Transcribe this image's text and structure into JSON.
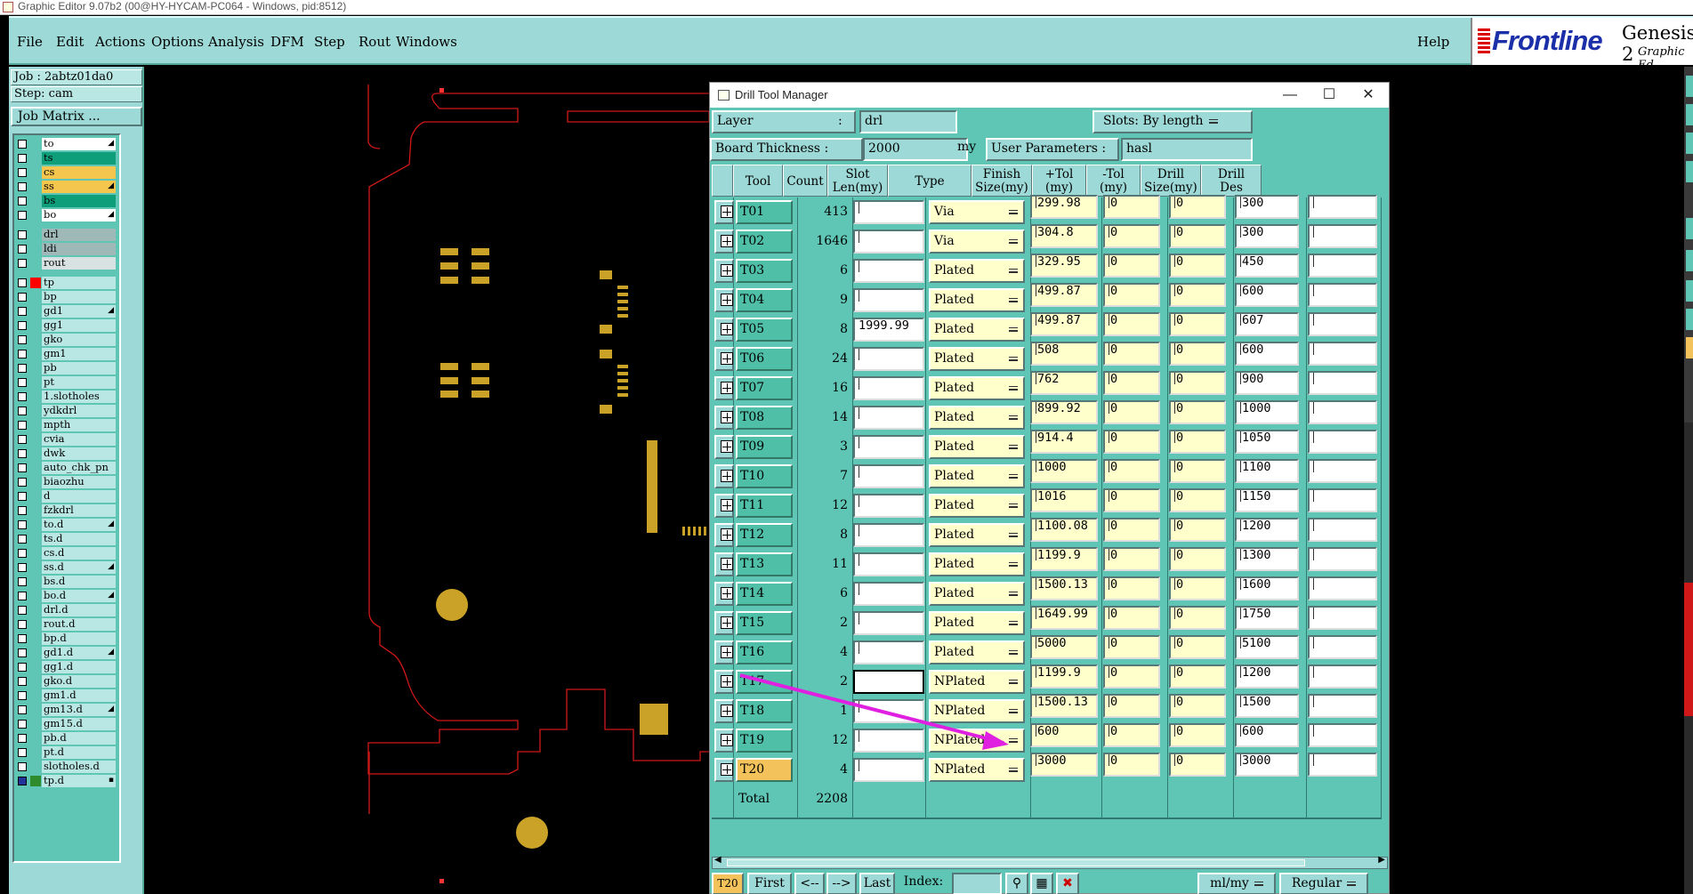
{
  "window": {
    "title": "Graphic Editor 9.07b2 (00@HY-HYCAM-PC064 - Windows, pid:8512)"
  },
  "menu": {
    "items": [
      "File",
      "Edit",
      "Actions",
      "Options",
      "Analysis",
      "DFM",
      "Step",
      "Rout",
      "Windows"
    ],
    "help": "Help"
  },
  "logo": {
    "brand": "Frontline",
    "product": "Genesis 2",
    "subtitle": "Graphic Ed"
  },
  "left_panel": {
    "job": "Job : 2abtz01da0",
    "step": "Step: cam",
    "job_matrix": "Job Matrix ...",
    "layers": [
      {
        "name": "to",
        "color": "#ffffff",
        "mark": "◢"
      },
      {
        "name": "ts",
        "color": "#0f9e7a",
        "mark": ""
      },
      {
        "name": "cs",
        "color": "#f5c64e",
        "mark": ""
      },
      {
        "name": "ss",
        "color": "#f5c64e",
        "mark": "◢"
      },
      {
        "name": "bs",
        "color": "#0f9e7a",
        "mark": ""
      },
      {
        "name": "bo",
        "color": "#ffffff",
        "mark": "◢"
      },
      {
        "name": "drl",
        "color": "#9fb8b8",
        "mark": ""
      },
      {
        "name": "ldi",
        "color": "#9fb8b8",
        "mark": ""
      },
      {
        "name": "rout",
        "color": "#d8e2e2",
        "mark": ""
      },
      {
        "name": "tp",
        "color": "#b9e7e4",
        "mark": ""
      },
      {
        "name": "bp",
        "color": "#b9e7e4",
        "mark": ""
      },
      {
        "name": "gd1",
        "color": "#b9e7e4",
        "mark": "◢"
      },
      {
        "name": "gg1",
        "color": "#b9e7e4",
        "mark": ""
      },
      {
        "name": "gko",
        "color": "#b9e7e4",
        "mark": ""
      },
      {
        "name": "gm1",
        "color": "#b9e7e4",
        "mark": ""
      },
      {
        "name": "pb",
        "color": "#b9e7e4",
        "mark": ""
      },
      {
        "name": "pt",
        "color": "#b9e7e4",
        "mark": ""
      },
      {
        "name": "1.slotholes",
        "color": "#b9e7e4",
        "mark": ""
      },
      {
        "name": "ydkdrl",
        "color": "#b9e7e4",
        "mark": ""
      },
      {
        "name": "mpth",
        "color": "#b9e7e4",
        "mark": ""
      },
      {
        "name": "cvia",
        "color": "#b9e7e4",
        "mark": ""
      },
      {
        "name": "dwk",
        "color": "#b9e7e4",
        "mark": ""
      },
      {
        "name": "auto_chk_pn",
        "color": "#b9e7e4",
        "mark": ""
      },
      {
        "name": "biaozhu",
        "color": "#b9e7e4",
        "mark": ""
      },
      {
        "name": "d",
        "color": "#b9e7e4",
        "mark": ""
      },
      {
        "name": "fzkdrl",
        "color": "#b9e7e4",
        "mark": ""
      },
      {
        "name": "to.d",
        "color": "#b9e7e4",
        "mark": "◢"
      },
      {
        "name": "ts.d",
        "color": "#b9e7e4",
        "mark": ""
      },
      {
        "name": "cs.d",
        "color": "#b9e7e4",
        "mark": ""
      },
      {
        "name": "ss.d",
        "color": "#b9e7e4",
        "mark": "◢"
      },
      {
        "name": "bs.d",
        "color": "#b9e7e4",
        "mark": ""
      },
      {
        "name": "bo.d",
        "color": "#b9e7e4",
        "mark": "◢"
      },
      {
        "name": "drl.d",
        "color": "#b9e7e4",
        "mark": ""
      },
      {
        "name": "rout.d",
        "color": "#b9e7e4",
        "mark": ""
      },
      {
        "name": "bp.d",
        "color": "#b9e7e4",
        "mark": ""
      },
      {
        "name": "gd1.d",
        "color": "#b9e7e4",
        "mark": "◢"
      },
      {
        "name": "gg1.d",
        "color": "#b9e7e4",
        "mark": ""
      },
      {
        "name": "gko.d",
        "color": "#b9e7e4",
        "mark": ""
      },
      {
        "name": "gm1.d",
        "color": "#b9e7e4",
        "mark": ""
      },
      {
        "name": "gm13.d",
        "color": "#b9e7e4",
        "mark": "◢"
      },
      {
        "name": "gm15.d",
        "color": "#b9e7e4",
        "mark": ""
      },
      {
        "name": "pb.d",
        "color": "#b9e7e4",
        "mark": ""
      },
      {
        "name": "pt.d",
        "color": "#b9e7e4",
        "mark": ""
      },
      {
        "name": "slotholes.d",
        "color": "#b9e7e4",
        "mark": ""
      },
      {
        "name": "tp.d",
        "color": "#b9e7e4",
        "mark": "▪"
      }
    ],
    "tp_swatch_color": "#ff0000",
    "tpd_swatch_color": "#2e8b2e"
  },
  "dialog": {
    "title": "Drill Tool Manager",
    "layer_label": "Layer",
    "layer_label_colon": ":",
    "layer_value": "drl",
    "slots_label": "Slots:",
    "slots_value": "By length",
    "board_thickness_label": "Board Thickness :",
    "board_thickness_value": "2000",
    "board_thickness_unit": "my",
    "user_params_label": "User Parameters :",
    "user_params_value": "hasl",
    "columns": [
      "Tool",
      "Count",
      "Slot\nLen(my)",
      "Type",
      "Finish\nSize(my)",
      "+Tol\n(my)",
      "-Tol\n(my)",
      "Drill\nSize(my)",
      "Drill\nDes"
    ],
    "rows": [
      {
        "tool": "T01",
        "count": "413",
        "slot": "",
        "type": "Via",
        "finish": "299.98",
        "ptol": "0",
        "mtol": "0",
        "drill": "300",
        "des": ""
      },
      {
        "tool": "T02",
        "count": "1646",
        "slot": "",
        "type": "Via",
        "finish": "304.8",
        "ptol": "0",
        "mtol": "0",
        "drill": "300",
        "des": ""
      },
      {
        "tool": "T03",
        "count": "6",
        "slot": "",
        "type": "Plated",
        "finish": "329.95",
        "ptol": "0",
        "mtol": "0",
        "drill": "450",
        "des": ""
      },
      {
        "tool": "T04",
        "count": "9",
        "slot": "",
        "type": "Plated",
        "finish": "499.87",
        "ptol": "0",
        "mtol": "0",
        "drill": "600",
        "des": ""
      },
      {
        "tool": "T05",
        "count": "8",
        "slot": "1999.99",
        "type": "Plated",
        "finish": "499.87",
        "ptol": "0",
        "mtol": "0",
        "drill": "607",
        "des": ""
      },
      {
        "tool": "T06",
        "count": "24",
        "slot": "",
        "type": "Plated",
        "finish": "508",
        "ptol": "0",
        "mtol": "0",
        "drill": "600",
        "des": ""
      },
      {
        "tool": "T07",
        "count": "16",
        "slot": "",
        "type": "Plated",
        "finish": "762",
        "ptol": "0",
        "mtol": "0",
        "drill": "900",
        "des": ""
      },
      {
        "tool": "T08",
        "count": "14",
        "slot": "",
        "type": "Plated",
        "finish": "899.92",
        "ptol": "0",
        "mtol": "0",
        "drill": "1000",
        "des": ""
      },
      {
        "tool": "T09",
        "count": "3",
        "slot": "",
        "type": "Plated",
        "finish": "914.4",
        "ptol": "0",
        "mtol": "0",
        "drill": "1050",
        "des": ""
      },
      {
        "tool": "T10",
        "count": "7",
        "slot": "",
        "type": "Plated",
        "finish": "1000",
        "ptol": "0",
        "mtol": "0",
        "drill": "1100",
        "des": ""
      },
      {
        "tool": "T11",
        "count": "12",
        "slot": "",
        "type": "Plated",
        "finish": "1016",
        "ptol": "0",
        "mtol": "0",
        "drill": "1150",
        "des": ""
      },
      {
        "tool": "T12",
        "count": "8",
        "slot": "",
        "type": "Plated",
        "finish": "1100.08",
        "ptol": "0",
        "mtol": "0",
        "drill": "1200",
        "des": ""
      },
      {
        "tool": "T13",
        "count": "11",
        "slot": "",
        "type": "Plated",
        "finish": "1199.9",
        "ptol": "0",
        "mtol": "0",
        "drill": "1300",
        "des": ""
      },
      {
        "tool": "T14",
        "count": "6",
        "slot": "",
        "type": "Plated",
        "finish": "1500.13",
        "ptol": "0",
        "mtol": "0",
        "drill": "1600",
        "des": ""
      },
      {
        "tool": "T15",
        "count": "2",
        "slot": "",
        "type": "Plated",
        "finish": "1649.99",
        "ptol": "0",
        "mtol": "0",
        "drill": "1750",
        "des": ""
      },
      {
        "tool": "T16",
        "count": "4",
        "slot": "",
        "type": "Plated",
        "finish": "5000",
        "ptol": "0",
        "mtol": "0",
        "drill": "5100",
        "des": ""
      },
      {
        "tool": "T17",
        "count": "2",
        "slot": "",
        "type": "NPlated",
        "finish": "1199.9",
        "ptol": "0",
        "mtol": "0",
        "drill": "1200",
        "des": ""
      },
      {
        "tool": "T18",
        "count": "1",
        "slot": "",
        "type": "NPlated",
        "finish": "1500.13",
        "ptol": "0",
        "mtol": "0",
        "drill": "1500",
        "des": ""
      },
      {
        "tool": "T19",
        "count": "12",
        "slot": "",
        "type": "NPlated",
        "finish": "600",
        "ptol": "0",
        "mtol": "0",
        "drill": "600",
        "des": ""
      },
      {
        "tool": "T20",
        "count": "4",
        "slot": "",
        "type": "NPlated",
        "finish": "3000",
        "ptol": "0",
        "mtol": "0",
        "drill": "3000",
        "des": ""
      }
    ],
    "total_label": "Total",
    "total_value": "2208",
    "bottom": {
      "current_tool": "T20",
      "first": "First",
      "prev": "<--",
      "next": "-->",
      "last": "Last",
      "index_label": "Index:",
      "units": "ml/my",
      "mode": "Regular"
    }
  },
  "colors": {
    "panel": "#9dd9d6",
    "dialog_bg": "#5fc6b6",
    "tool_active": "#f3c25a",
    "arrow": "#e020e0",
    "pcb_outline": "#d01818",
    "pcb_copper": "#c9a227"
  }
}
